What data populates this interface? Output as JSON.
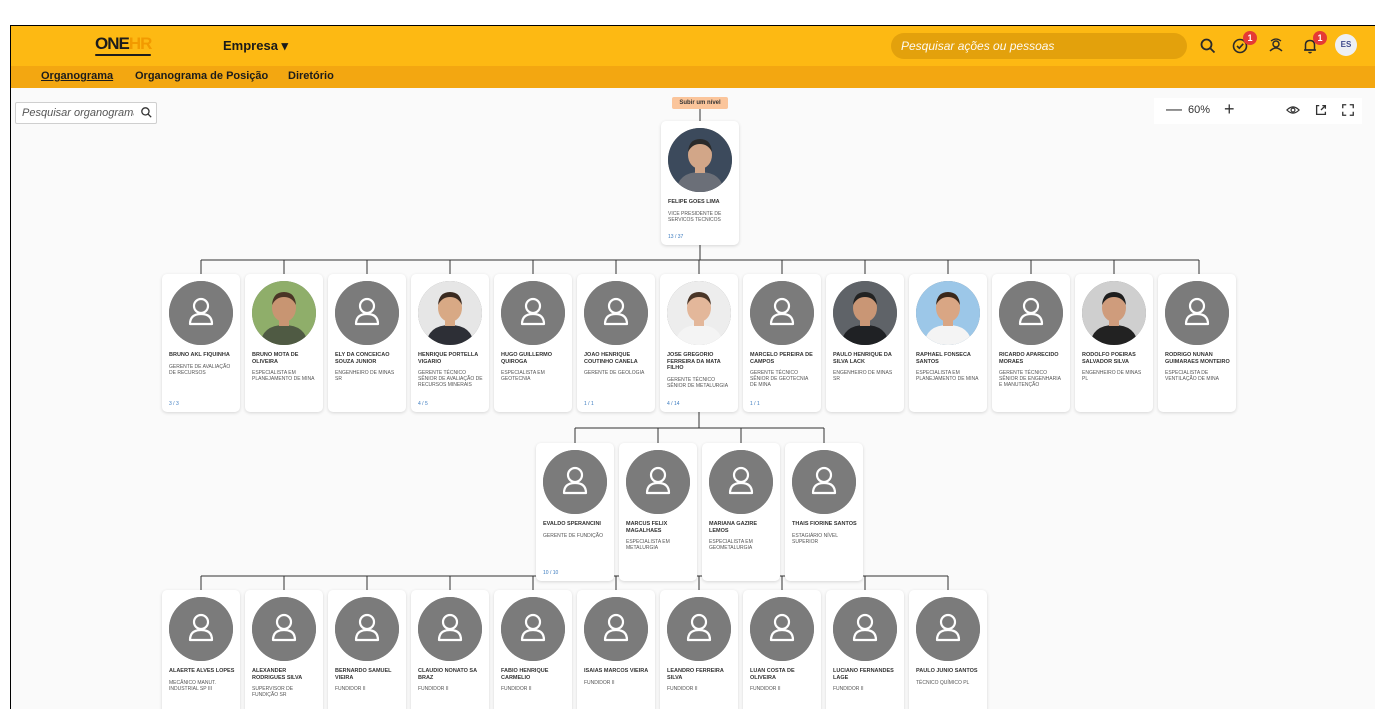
{
  "header": {
    "logo_one": "ONE",
    "logo_hr": "HR",
    "company": "Empresa",
    "search_placeholder": "Pesquisar ações ou pessoas",
    "tasks_badge": "1",
    "notifications_badge": "1",
    "user_initials": "ES",
    "colors": {
      "bar": "#fdb913",
      "subbar": "#f3a711",
      "badge": "#e53935"
    }
  },
  "subnav": {
    "tabs": [
      "Organograma",
      "Organograma de Posição",
      "Diretório"
    ],
    "active": "Organograma"
  },
  "org_search": {
    "placeholder": "Pesquisar organograma"
  },
  "zoom": {
    "level": "60%"
  },
  "up_level": "Subir um nível",
  "root": {
    "name": "FELIPE GOES LIMA",
    "role": "VICE PRESIDENTE DE SERVICOS TECNICOS",
    "count": "13 / 37",
    "photo": "photo-dark"
  },
  "level1": [
    {
      "name": "BRUNO AKL FIQUINHA",
      "role": "GERENTE DE AVALIAÇÃO DE RECURSOS",
      "count": "3 / 3",
      "photo": "placeholder"
    },
    {
      "name": "BRUNO MOTA DE OLIVEIRA",
      "role": "ESPECIALISTA EM PLANEJAMENTO DE MINA",
      "count": "",
      "photo": "photo-outdoor"
    },
    {
      "name": "ELY DA CONCEICAO SOUZA JUNIOR",
      "role": "ENGENHEIRO DE MINAS SR",
      "count": "",
      "photo": "placeholder"
    },
    {
      "name": "HENRIQUE PORTELLA VIGARIO",
      "role": "GERENTE TÉCNICO SÊNIOR DE AVALIAÇÃO DE RECURSOS MINERAIS",
      "count": "4 / 5",
      "photo": "photo-suit"
    },
    {
      "name": "HUGO GUILLERMO QUIROGA",
      "role": "ESPECIALISTA EM GEOTECNIA",
      "count": "",
      "photo": "placeholder"
    },
    {
      "name": "JOAO HENRIQUE COUTINHO CANELA",
      "role": "GERENTE DE GEOLOGIA",
      "count": "1 / 1",
      "photo": "placeholder"
    },
    {
      "name": "JOSE GREGORIO FERREIRA DA MATA FILHO",
      "role": "GERENTE TÉCNICO SÊNIOR DE METALURGIA",
      "count": "4 / 14",
      "photo": "photo-light"
    },
    {
      "name": "MARCELO PEREIRA DE CAMPOS",
      "role": "GERENTE TÉCNICO SÊNIOR DE GEOTECNIA DE MINA",
      "count": "1 / 1",
      "photo": "placeholder"
    },
    {
      "name": "PAULO HENRIQUE DA SILVA LACK",
      "role": "ENGENHEIRO DE MINAS SR",
      "count": "",
      "photo": "photo-glasses"
    },
    {
      "name": "RAPHAEL FONSECA SANTOS",
      "role": "ESPECIALISTA EM PLANEJAMENTO DE MINA",
      "count": "",
      "photo": "photo-sky"
    },
    {
      "name": "RICARDO APARECIDO MORAES",
      "role": "GERENTE TÉCNICO SÊNIOR DE ENGENHARIA E MANUTENÇÃO",
      "count": "",
      "photo": "placeholder"
    },
    {
      "name": "RODOLFO POEIRAS SALVADOR SILVA",
      "role": "ENGENHEIRO DE MINAS PL",
      "count": "",
      "photo": "photo-beard"
    },
    {
      "name": "RODRIGO NUNAN GUIMARAES MONTEIRO",
      "role": "ESPECIALISTA DE VENTILAÇÃO DE MINA",
      "count": "",
      "photo": "placeholder"
    }
  ],
  "level2": [
    {
      "name": "EVALDO SPERANCINI",
      "role": "GERENTE DE FUNDIÇÃO",
      "count": "10 / 10",
      "photo": "placeholder"
    },
    {
      "name": "MARCUS FELIX MAGALHAES",
      "role": "ESPECIALISTA EM METALURGIA",
      "count": "",
      "photo": "placeholder"
    },
    {
      "name": "MARIANA GAZIRE LEMOS",
      "role": "ESPECIALISTA EM GEOMETALURGIA",
      "count": "",
      "photo": "placeholder"
    },
    {
      "name": "THAIS FIORINE SANTOS",
      "role": "ESTAGIÁRIO NÍVEL SUPERIOR",
      "count": "",
      "photo": "placeholder"
    }
  ],
  "level3": [
    {
      "name": "ALAERTE ALVES LOPES",
      "role": "MECÂNICO MANUT. INDUSTRIAL SP III",
      "count": "",
      "photo": "placeholder"
    },
    {
      "name": "ALEXANDER RODRIGUES SILVA",
      "role": "SUPERVISOR DE FUNDIÇÃO SR",
      "count": "",
      "photo": "placeholder"
    },
    {
      "name": "BERNARDO SAMUEL VIEIRA",
      "role": "FUNDIDOR II",
      "count": "",
      "photo": "placeholder"
    },
    {
      "name": "CLAUDIO NONATO SA BRAZ",
      "role": "FUNDIDOR II",
      "count": "",
      "photo": "placeholder"
    },
    {
      "name": "FABIO HENRIQUE CARMELIO",
      "role": "FUNDIDOR II",
      "count": "",
      "photo": "placeholder"
    },
    {
      "name": "ISAIAS MARCOS VIEIRA",
      "role": "FUNDIDOR II",
      "count": "",
      "photo": "placeholder"
    },
    {
      "name": "LEANDRO FERREIRA SILVA",
      "role": "FUNDIDOR II",
      "count": "",
      "photo": "placeholder"
    },
    {
      "name": "LUAN COSTA DE OLIVEIRA",
      "role": "FUNDIDOR II",
      "count": "",
      "photo": "placeholder"
    },
    {
      "name": "LUCIANO FERNANDES LAGE",
      "role": "FUNDIDOR II",
      "count": "",
      "photo": "placeholder"
    },
    {
      "name": "PAULO JUNIO SANTOS",
      "role": "TÉCNICO QUÍMICO PL",
      "count": "",
      "photo": "placeholder"
    }
  ]
}
